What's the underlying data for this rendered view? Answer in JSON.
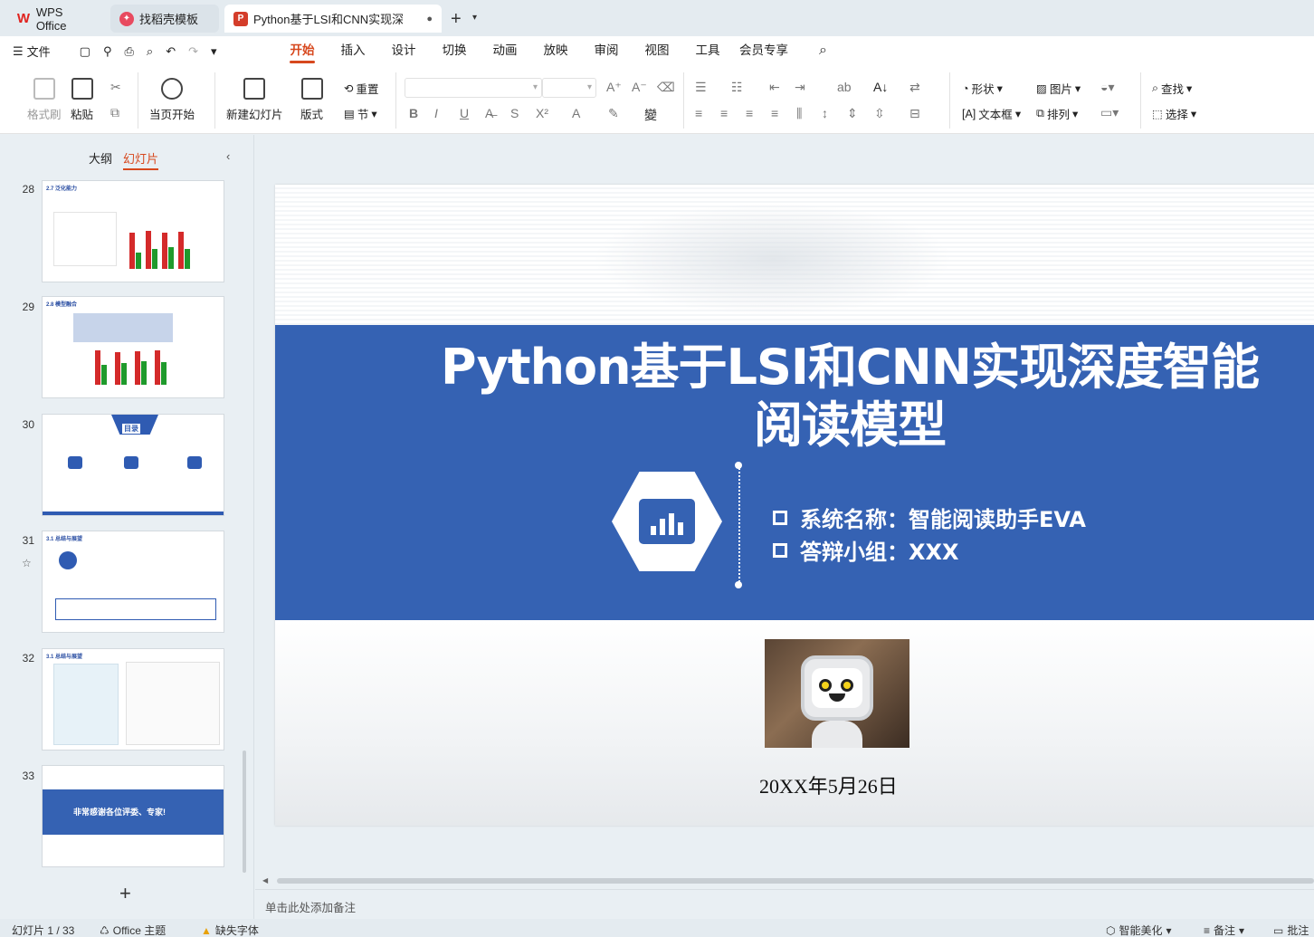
{
  "tabs": {
    "wps": "WPS Office",
    "template": "找稻壳模板",
    "document": "Python基于LSI和CNN实现深度"
  },
  "menu": {
    "file": "文件",
    "tabs": [
      "开始",
      "插入",
      "设计",
      "切换",
      "动画",
      "放映",
      "审阅",
      "视图",
      "工具",
      "会员专享"
    ],
    "active_tab": "开始"
  },
  "ribbon": {
    "format_painter": "格式刷",
    "paste": "粘贴",
    "from_current": "当页开始",
    "new_slide": "新建幻灯片",
    "layout": "版式",
    "reset": "重置",
    "section": "节",
    "shape": "形状",
    "picture": "图片",
    "find": "查找",
    "textbox": "文本框",
    "arrange": "排列",
    "select": "选择"
  },
  "sidebar": {
    "tab_outline": "大纲",
    "tab_slides": "幻灯片",
    "slides": [
      {
        "num": "28",
        "heading": "2.7 泛化能力"
      },
      {
        "num": "29",
        "heading": "2.8 模型融合"
      },
      {
        "num": "30",
        "heading": "目录"
      },
      {
        "num": "31",
        "heading": "3.1 总结与展望"
      },
      {
        "num": "32",
        "heading": "3.1 总结与展望"
      },
      {
        "num": "33",
        "heading": "非常感谢各位评委、专家!"
      }
    ]
  },
  "slide": {
    "title_line1": "Python基于LSI和CNN实现深度智能",
    "title_line2": "阅读模型",
    "bullet1": "系统名称：智能阅读助手EVA",
    "bullet2": "答辩小组：XXX",
    "date": "20XX年5月26日"
  },
  "notes_placeholder": "单击此处添加备注",
  "status": {
    "slide_counter": "幻灯片 1 / 33",
    "theme": "Office 主题",
    "missing_font": "缺失字体",
    "beautify": "智能美化",
    "notes": "备注",
    "comments": "批注"
  },
  "colors": {
    "accent": "#d7481e",
    "slide_blue": "#3562b3"
  }
}
